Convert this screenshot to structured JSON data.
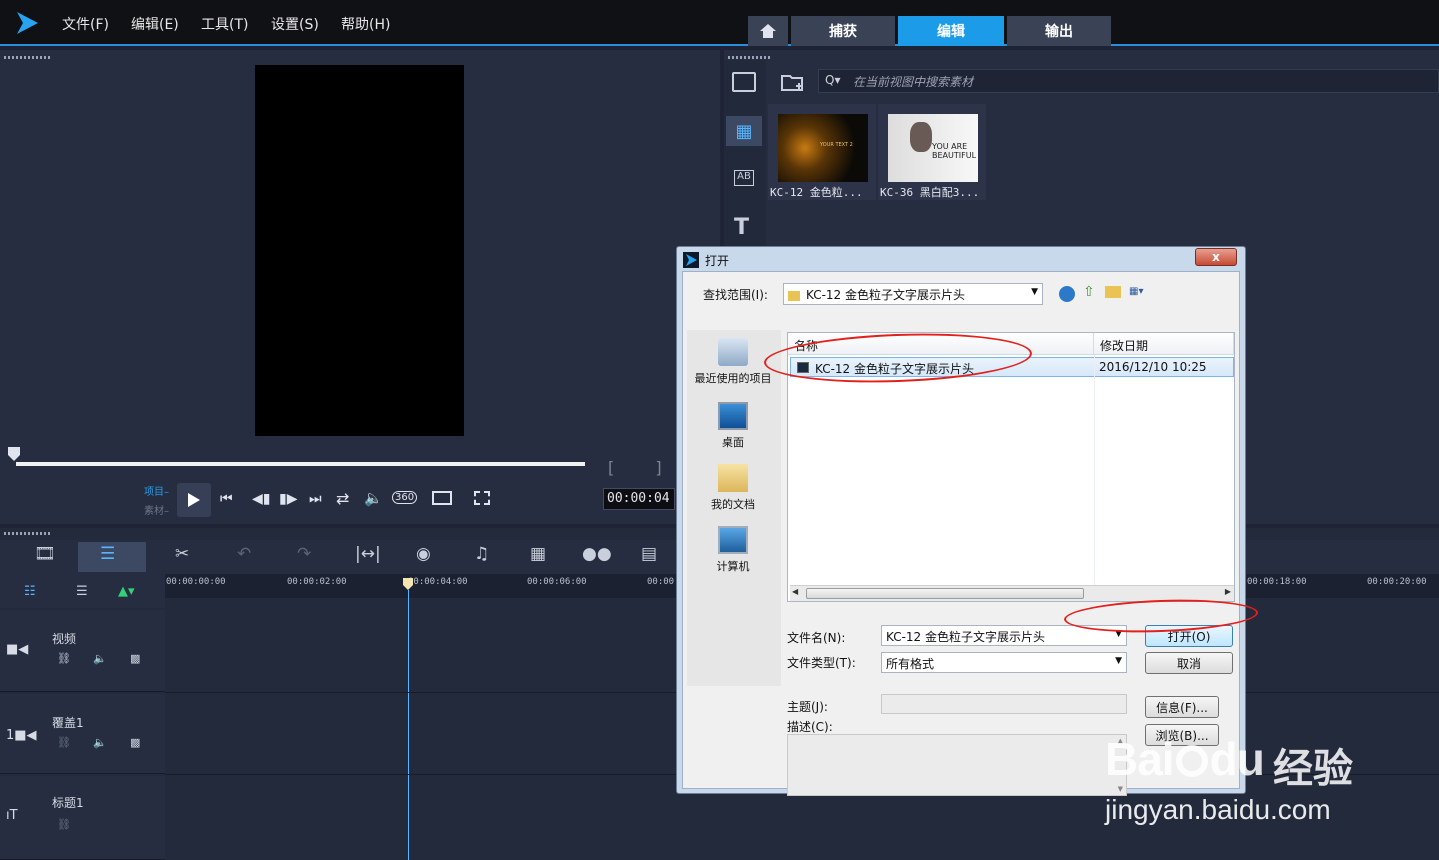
{
  "menu": [
    "文件(F)",
    "编辑(E)",
    "工具(T)",
    "设置(S)",
    "帮助(H)"
  ],
  "tabs": {
    "capture": "捕获",
    "edit": "编辑",
    "output": "输出"
  },
  "library": {
    "search_placeholder": "在当前视图中搜索素材",
    "thumbs": [
      {
        "caption": "KC-12 金色粒...",
        "inner_text": "YOUR TEXT 2"
      },
      {
        "caption": "KC-36 黑白配3...",
        "inner_text": "YOU ARE BEAUTIFUL"
      }
    ]
  },
  "player": {
    "project_label": "项目",
    "clip_label": "素材",
    "timecode": "00:00:04"
  },
  "ruler": [
    "00:00:00:00",
    "00:00:02:00",
    "00:00:04:00",
    "00:00:06:00",
    "00:00:",
    "00:00:18:00",
    "00:00:20:00"
  ],
  "tracks": [
    {
      "name": "视频"
    },
    {
      "name": "覆盖1"
    },
    {
      "name": "标题1"
    }
  ],
  "dialog": {
    "title": "打开",
    "close": "x",
    "lookin_label": "查找范围(I):",
    "lookin_value": "KC-12 金色粒子文字展示片头",
    "places": [
      "最近使用的项目",
      "桌面",
      "我的文档",
      "计算机"
    ],
    "col_name": "名称",
    "col_date": "修改日期",
    "file_name": "KC-12 金色粒子文字展示片头",
    "file_date": "2016/12/10 10:25",
    "filename_label": "文件名(N):",
    "filename_value": "KC-12 金色粒子文字展示片头",
    "filetype_label": "文件类型(T):",
    "filetype_value": "所有格式",
    "open_btn": "打开(O)",
    "cancel_btn": "取消",
    "subject_label": "主题(J):",
    "desc_label": "描述(C):",
    "info_btn": "信息(F)...",
    "browse_btn": "浏览(B)..."
  },
  "watermark": {
    "brand": "Bai",
    "brand2": "du",
    "suffix": "经验",
    "url": "jingyan.baidu.com"
  }
}
